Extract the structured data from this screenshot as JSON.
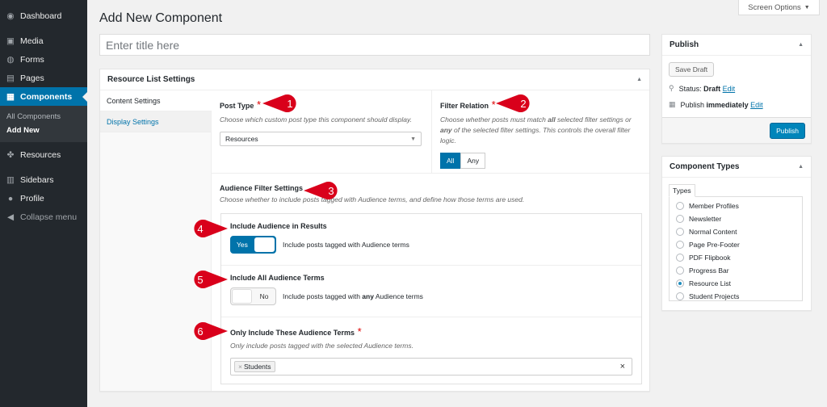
{
  "sidebar": {
    "items": [
      {
        "label": "Dashboard",
        "icon": "dashboard-icon",
        "glyph": "◉"
      },
      {
        "label": "Media",
        "icon": "media-icon",
        "glyph": "▣"
      },
      {
        "label": "Forms",
        "icon": "forms-icon",
        "glyph": "◍"
      },
      {
        "label": "Pages",
        "icon": "pages-icon",
        "glyph": "▤"
      },
      {
        "label": "Components",
        "icon": "components-icon",
        "glyph": "▦"
      }
    ],
    "submenu": [
      "All Components",
      "Add New"
    ],
    "items2": [
      {
        "label": "Resources",
        "icon": "resources-icon",
        "glyph": "✤"
      },
      {
        "label": "Sidebars",
        "icon": "sidebars-icon",
        "glyph": "▥"
      },
      {
        "label": "Profile",
        "icon": "profile-icon",
        "glyph": "●"
      },
      {
        "label": "Collapse menu",
        "icon": "collapse-icon",
        "glyph": "◀"
      }
    ]
  },
  "header": {
    "title": "Add New Component",
    "screen_options": "Screen Options",
    "title_placeholder": "Enter title here"
  },
  "settings": {
    "title": "Resource List Settings",
    "tabs": [
      "Content Settings",
      "Display Settings"
    ],
    "post_type": {
      "label": "Post Type",
      "req": "*",
      "desc": "Choose which custom post type this component should display.",
      "value": "Resources"
    },
    "filter_relation": {
      "label": "Filter Relation",
      "req": "*",
      "desc_a": "Choose whether posts must match ",
      "desc_all": "all",
      "desc_b": " selected filter settings or ",
      "desc_any": "any",
      "desc_c": " of the selected filter settings. This controls the overall filter logic.",
      "options": [
        "All",
        "Any"
      ]
    },
    "audience": {
      "label": "Audience Filter Settings",
      "desc": "Choose whether to include posts tagged with Audience terms, and define how those terms are used.",
      "include": {
        "label": "Include Audience in Results",
        "switch": "Yes",
        "text": "Include posts tagged with Audience terms"
      },
      "include_all": {
        "label": "Include All Audience Terms",
        "switch": "No",
        "text_a": "Include posts tagged with ",
        "text_b": "any",
        "text_c": " Audience terms"
      },
      "only": {
        "label": "Only Include These Audience Terms",
        "req": "*",
        "desc": "Only include posts tagged with the selected Audience terms.",
        "chip": "Students",
        "chip_x": "×",
        "clear": "×"
      }
    }
  },
  "badges": [
    "1",
    "2",
    "3",
    "4",
    "5",
    "6"
  ],
  "badge_color": "#d9001b",
  "publish": {
    "title": "Publish",
    "save_draft": "Save Draft",
    "status_label": "Status: ",
    "status_value": "Draft",
    "edit": "Edit",
    "publish_label": "Publish ",
    "publish_value": "immediately",
    "button": "Publish"
  },
  "types": {
    "title": "Component Types",
    "tab": "Types",
    "options": [
      "Member Profiles",
      "Newsletter",
      "Normal Content",
      "Page Pre-Footer",
      "PDF Flipbook",
      "Progress Bar",
      "Resource List",
      "Student Projects"
    ],
    "selected": "Resource List"
  }
}
